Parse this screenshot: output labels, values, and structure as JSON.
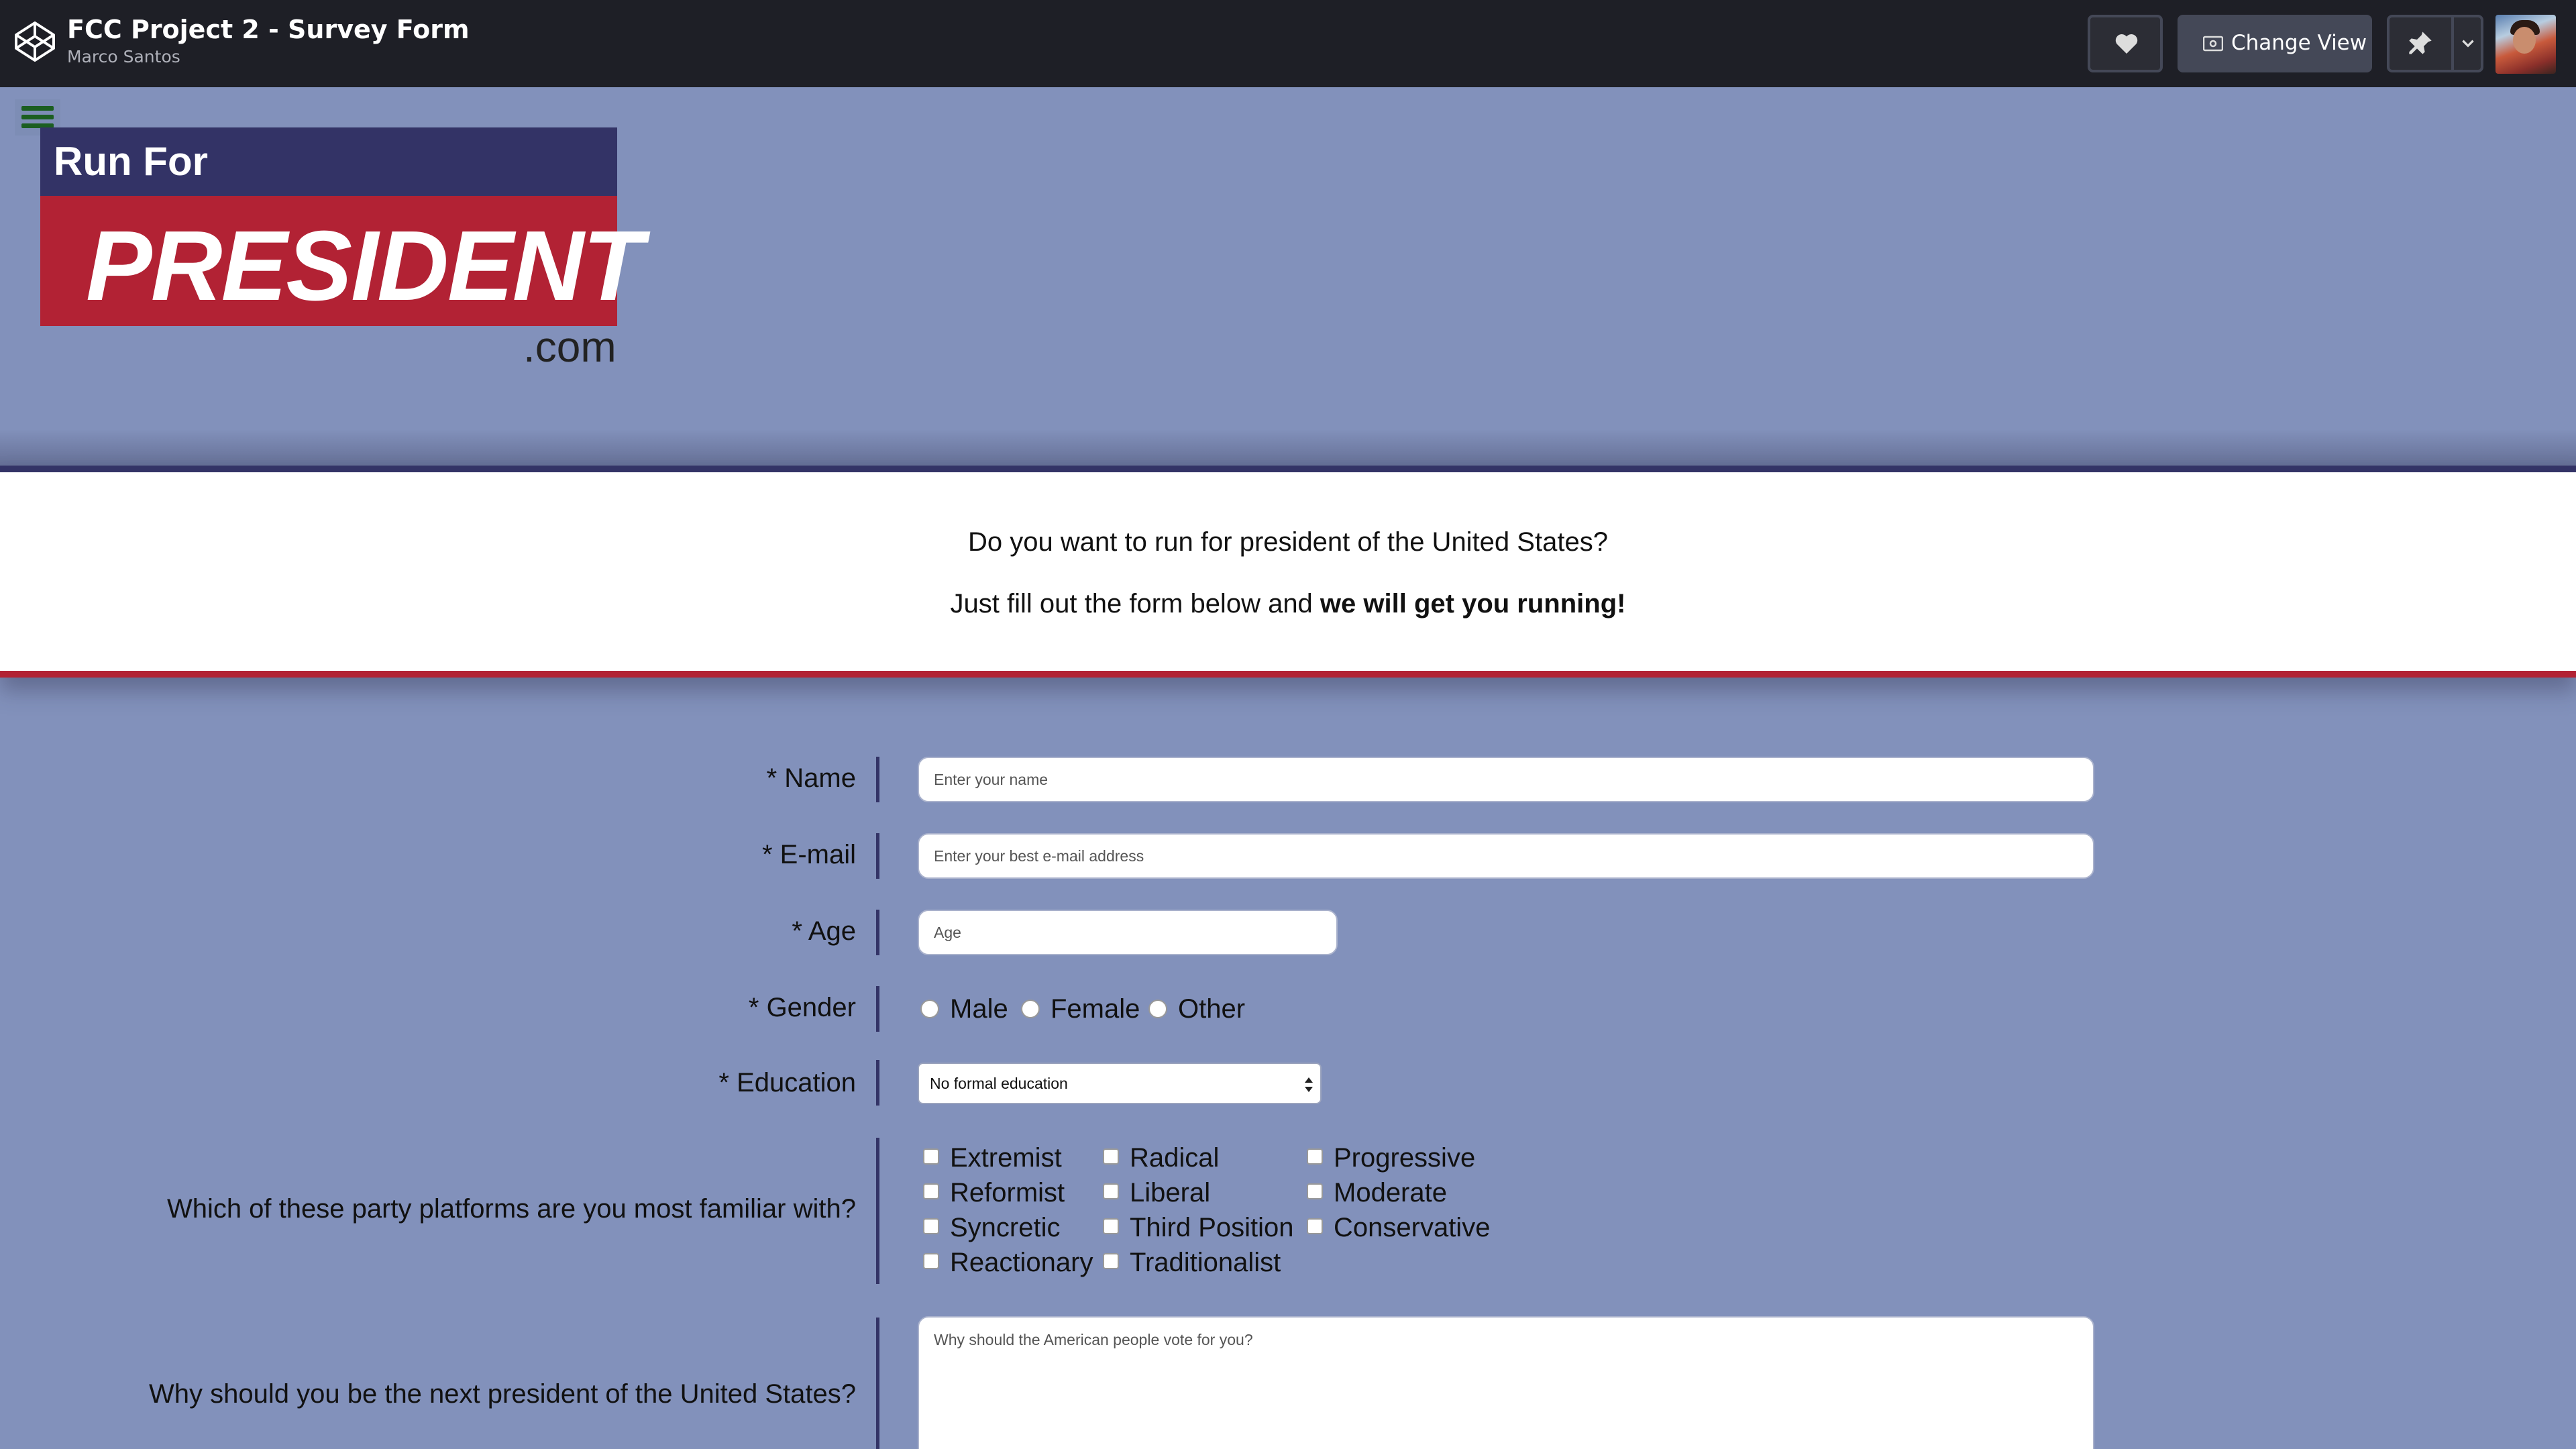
{
  "header": {
    "title": "FCC Project 2 - Survey Form",
    "author": "Marco Santos",
    "change_view_label": "Change View"
  },
  "logo": {
    "line1": "Run For",
    "line2": "PRESIDENT",
    "line3": ".com"
  },
  "banner": {
    "line1": "Do you want to run for president of the United States?",
    "line2_prefix": "Just fill out the form below and ",
    "line2_bold": "we will get you running!"
  },
  "form": {
    "name": {
      "label": "* Name",
      "placeholder": "Enter your name"
    },
    "email": {
      "label": "* E-mail",
      "placeholder": "Enter your best e-mail address"
    },
    "age": {
      "label": "* Age",
      "placeholder": "Age"
    },
    "gender": {
      "label": "* Gender",
      "options": [
        "Male",
        "Female",
        "Other"
      ]
    },
    "education": {
      "label": "* Education",
      "value": "No formal education"
    },
    "platforms": {
      "label": "Which of these party platforms are you most familiar with?",
      "col1": [
        "Extremist",
        "Reformist",
        "Syncretic",
        "Reactionary"
      ],
      "col2": [
        "Radical",
        "Liberal",
        "Third Position",
        "Traditionalist"
      ],
      "col3": [
        "Progressive",
        "Moderate",
        "Conservative"
      ]
    },
    "why": {
      "label": "Why should you be the next president of the United States?",
      "placeholder": "Why should the American people vote for you?"
    }
  },
  "colors": {
    "background": "#8291bb",
    "navy": "#333366",
    "red": "#b22234",
    "topbar": "#1e1f26"
  },
  "icons": [
    "codepen-logo-icon",
    "heart-icon",
    "eye-icon",
    "pin-icon",
    "chevron-down-icon",
    "hamburger-menu-icon"
  ]
}
